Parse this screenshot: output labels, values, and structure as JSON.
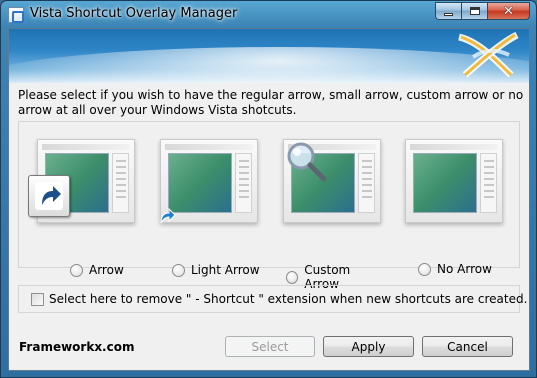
{
  "window": {
    "title": "Vista Shortcut Overlay Manager"
  },
  "prompt": "Please select if you wish to have the regular arrow, small arrow, custom arrow or no arrow at all over your Windows Vista shotcuts.",
  "options": [
    {
      "label": "Arrow",
      "selected": false,
      "icon": "shortcut-arrow-icon"
    },
    {
      "label": "Light Arrow",
      "selected": false,
      "icon": "small-arrow-icon"
    },
    {
      "label": "Custom Arrow",
      "selected": false,
      "icon": "magnifier-icon"
    },
    {
      "label": "No Arrow",
      "selected": false,
      "icon": "none"
    }
  ],
  "remove_extension": {
    "label": "Select here to remove \" - Shortcut \" extension when new shortcuts are created.",
    "checked": false
  },
  "brand": "Frameworkx.com",
  "buttons": {
    "select": "Select",
    "apply": "Apply",
    "cancel": "Cancel"
  },
  "colors": {
    "accent": "#2f86c7",
    "title_bar": "#3b84b4"
  }
}
